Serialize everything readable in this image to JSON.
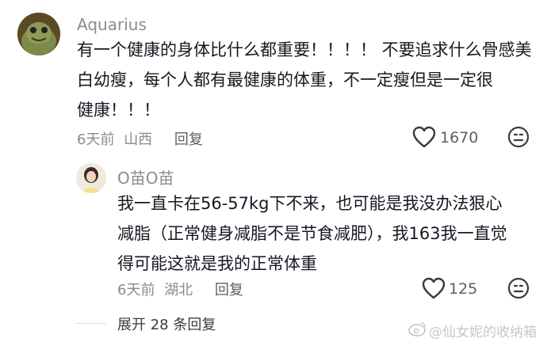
{
  "comment": {
    "username": "Aquarius",
    "lines": [
      "有一个健康的身体比什么都重要！！！！ 不要追求什么骨感美",
      "白幼瘦，每个人都有最健康的体重，不一定瘦但是一定很",
      "健康！！！"
    ],
    "time": "6天前",
    "location": "山西",
    "reply_label": "回复",
    "like_count": "1670"
  },
  "reply_comment": {
    "username": "O苗O苗",
    "lines": [
      "我一直卡在56-57kg下不来，也可能是我没办法狠心",
      "减脂（正常健身减脂不是节食减肥），我163我一直觉",
      "得可能这就是我的正常体重"
    ],
    "time": "6天前",
    "location": "湖北",
    "reply_label": "回复",
    "like_count": "125"
  },
  "expand_label": "展开 28 条回复",
  "watermark": "@仙女妮的收纳箱",
  "icons": {
    "like": "heart-outline-icon",
    "dislike": "frown-face-icon",
    "watermark_logo": "weibo-logo-icon"
  }
}
